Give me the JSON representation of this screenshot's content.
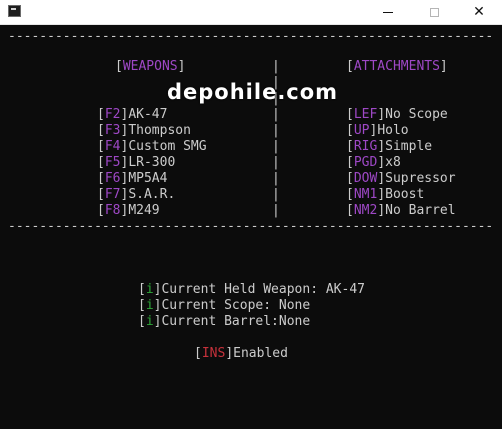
{
  "window": {
    "minimize_glyph": "—",
    "maximize_glyph": "☐",
    "close_glyph": "✕",
    "icon": "console-app-icon"
  },
  "console": {
    "divider_top": "--------------------------------------------------------------",
    "divider_bottom": "--------------------------------------------------------------",
    "weapons_header": "WEAPONS",
    "attachments_header": "ATTACHMENTS",
    "separator": "|",
    "weapons": [
      {
        "key": "F2",
        "name": "AK-47"
      },
      {
        "key": "F3",
        "name": "Thompson"
      },
      {
        "key": "F4",
        "name": "Custom SMG"
      },
      {
        "key": "F5",
        "name": "LR-300"
      },
      {
        "key": "F6",
        "name": "MP5A4"
      },
      {
        "key": "F7",
        "name": "S.A.R."
      },
      {
        "key": "F8",
        "name": "M249"
      }
    ],
    "attachments": [
      {
        "key": "LEF",
        "name": "No Scope"
      },
      {
        "key": "UP",
        "name": "Holo"
      },
      {
        "key": "RIG",
        "name": "Simple"
      },
      {
        "key": "PGD",
        "name": "x8"
      },
      {
        "key": "DOW",
        "name": "Supressor"
      },
      {
        "key": "NM1",
        "name": "Boost"
      },
      {
        "key": "NM2",
        "name": "No Barrel"
      }
    ],
    "status": [
      {
        "tag": "i",
        "text": "Current Held Weapon: AK-47"
      },
      {
        "tag": "i",
        "text": "Current Scope: None"
      },
      {
        "tag": "i",
        "text": "Current Barrel:None"
      }
    ],
    "toggle": {
      "tag": "INS",
      "text": "Enabled"
    }
  },
  "watermark": "depohile.com",
  "colors": {
    "background": "#0c0c0c",
    "text": "#cccccc",
    "key": "#9e48c6",
    "info": "#2ea838",
    "toggle": "#c7313b"
  }
}
